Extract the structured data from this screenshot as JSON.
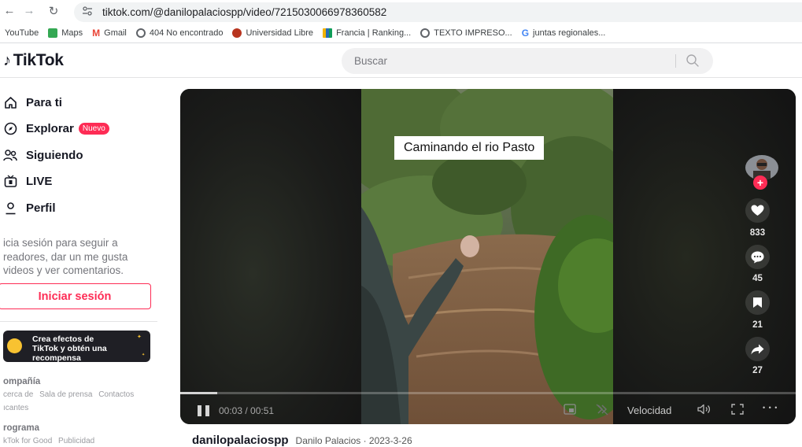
{
  "browser": {
    "url": "tiktok.com/@danilopalaciospp/video/7215030066978360582",
    "nav": {
      "back": "←",
      "forward": "→",
      "reload": "↻"
    },
    "bookmarks": [
      {
        "label": "YouTube",
        "icon": "youtube-icon",
        "color": "#ffffff"
      },
      {
        "label": "Maps",
        "icon": "maps-icon",
        "color": "#34a853"
      },
      {
        "label": "Gmail",
        "icon": "gmail-icon",
        "color": "#ea4335"
      },
      {
        "label": "404 No encontrado",
        "icon": "globe-icon",
        "color": "#5f6368"
      },
      {
        "label": "Universidad Libre",
        "icon": "university-icon",
        "color": "#b8351f"
      },
      {
        "label": "Francia | Ranking...",
        "icon": "ranking-icon",
        "color": "#2a6db5"
      },
      {
        "label": "TEXTO IMPRESO...",
        "icon": "globe-icon",
        "color": "#5f6368"
      },
      {
        "label": "juntas regionales...",
        "icon": "google-icon",
        "color": "#4285f4"
      }
    ]
  },
  "header": {
    "logo": "TikTok",
    "search_placeholder": "Buscar"
  },
  "sidebar": {
    "items": [
      {
        "label": "Para ti",
        "icon": "home-icon"
      },
      {
        "label": "Explorar",
        "icon": "compass-icon",
        "badge": "Nuevo"
      },
      {
        "label": "Siguiendo",
        "icon": "following-icon"
      },
      {
        "label": "LIVE",
        "icon": "live-icon"
      },
      {
        "label": "Perfil",
        "icon": "profile-icon"
      }
    ],
    "login_prompt": "icia sesión para seguir a readores, dar un me gusta videos y ver comentarios.",
    "login_button": "Iniciar sesión",
    "effects_banner": {
      "line1": "Crea efectos de",
      "line2": "TikTok y obtén una",
      "line3": "recompensa"
    },
    "footer": [
      {
        "heading": "ompañía",
        "links": [
          "cerca de",
          "Sala de prensa",
          "Contactos",
          "ıcantes"
        ]
      },
      {
        "heading": "rograma",
        "links": [
          "kTok for Good",
          "Publicidad"
        ]
      }
    ]
  },
  "video": {
    "caption": "Caminando el rio Pasto",
    "time": "00:03 / 00:51",
    "progress_fraction": 0.06,
    "speed_label": "Velocidad",
    "more": "• • •",
    "actions": {
      "likes": "833",
      "comments": "45",
      "saves": "21",
      "shares": "27"
    }
  },
  "author": {
    "username": "danilopalaciospp",
    "display": "Danilo Palacios · 2023-3-26"
  },
  "colors": {
    "brand": "#fe2c55",
    "text": "#161823",
    "muted": "#75767c"
  }
}
